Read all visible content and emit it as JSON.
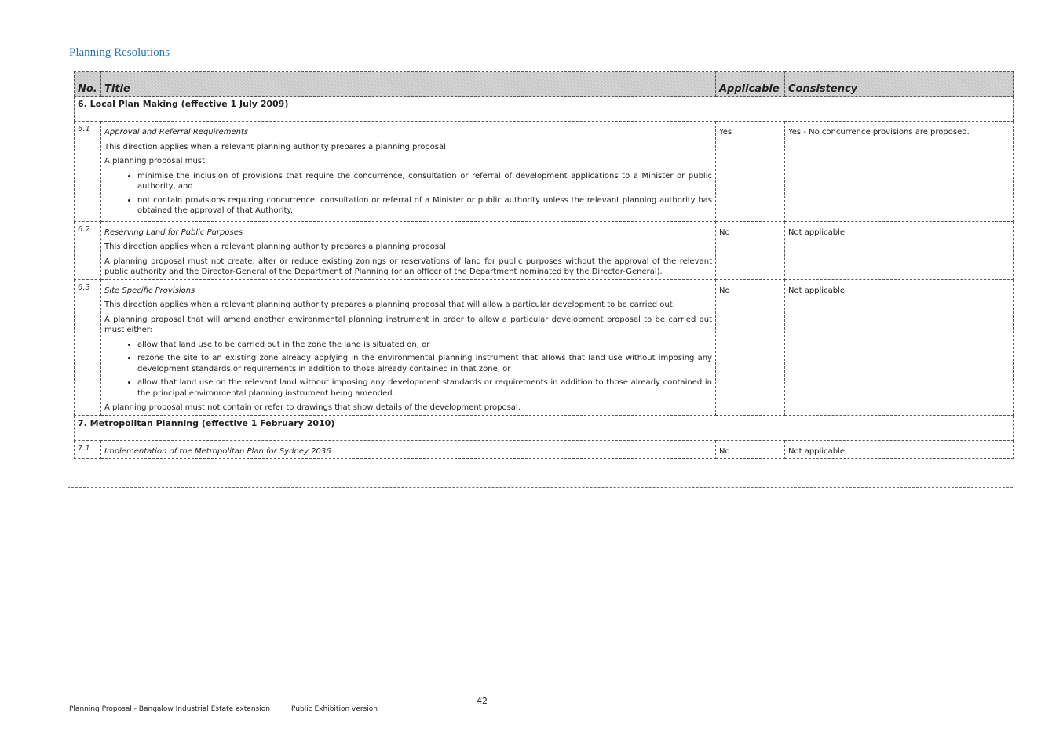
{
  "heading": "Planning Resolutions",
  "table": {
    "headers": {
      "no": "No.",
      "title": "Title",
      "applicable": "Applicable",
      "consistency": "Consistency"
    },
    "sections": [
      {
        "title": "6. Local Plan Making (effective 1 July 2009)",
        "rows": [
          {
            "no": "6.1",
            "title": "Approval and Referral Requirements",
            "paras": [
              "This direction applies when a relevant planning authority prepares a planning proposal.",
              "A planning proposal must:"
            ],
            "bullets": [
              "minimise the inclusion of provisions that require the concurrence, consultation or referral of development applications to a Minister or public authority, and",
              "not contain provisions requiring concurrence, consultation or referral of a Minister or public authority unless the relevant planning authority has obtained the approval of that Authority."
            ],
            "after": "",
            "applicable": "Yes",
            "consistency": "Yes - No concurrence provisions are proposed."
          },
          {
            "no": "6.2",
            "title": "Reserving Land for Public Purposes",
            "paras": [
              "This direction applies when a relevant planning authority prepares a planning proposal.",
              "A planning proposal must not create, alter or reduce existing zonings or reservations of land for public purposes without the approval of the relevant public authority and the Director-General of the Department of Planning (or an officer of the Department nominated by the Director-General)."
            ],
            "bullets": [],
            "after": "",
            "applicable": "No",
            "consistency": "Not applicable"
          },
          {
            "no": "6.3",
            "title": "Site Specific Provisions",
            "paras": [
              "This direction applies when a relevant planning authority prepares a planning proposal that will allow a particular development to be carried out.",
              "A planning proposal that will amend another environmental planning instrument in order to allow a particular development proposal to be carried out must either:"
            ],
            "bullets": [
              "allow that land use to be carried out in the zone the land is situated on, or",
              "rezone the site to an existing zone already applying in the environmental planning instrument that allows that land use without imposing any development standards or requirements in addition to those already contained in that zone, or",
              "allow that land use on the relevant land without imposing any development standards or requirements in addition to those already contained in the principal environmental planning instrument being amended."
            ],
            "after": "A planning proposal must not contain or refer to drawings that show details of the development proposal.",
            "applicable": "No",
            "consistency": "Not applicable"
          }
        ]
      },
      {
        "title": "7. Metropolitan Planning (effective 1 February 2010)",
        "rows": [
          {
            "no": "7.1",
            "title": "Implementation of the Metropolitan Plan for Sydney 2036",
            "paras": [],
            "bullets": [],
            "after": "",
            "applicable": "No",
            "consistency": "Not applicable"
          }
        ]
      }
    ]
  },
  "page_number": "42",
  "footer": {
    "left": "Planning Proposal - Bangalow Industrial Estate extension",
    "right": "Public Exhibition version"
  }
}
